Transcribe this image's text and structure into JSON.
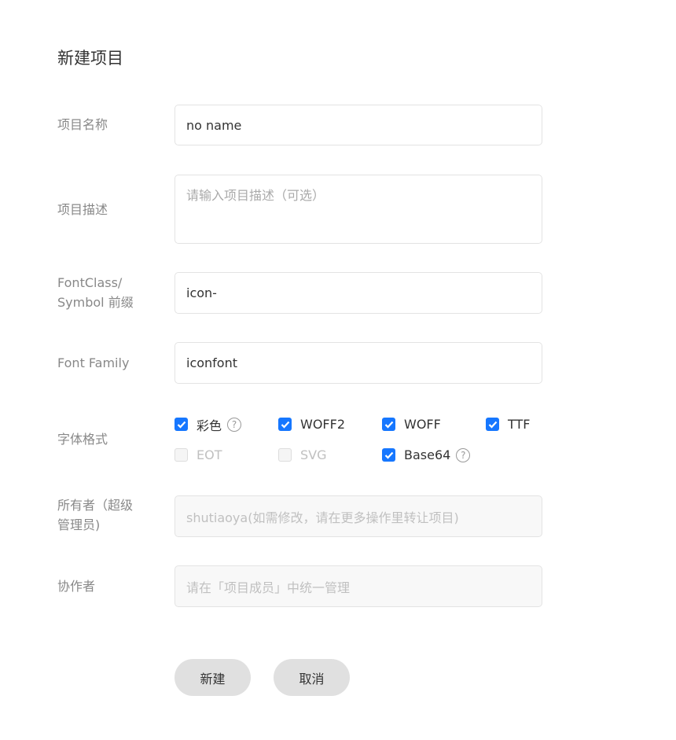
{
  "title": "新建项目",
  "fields": {
    "name": {
      "label": "项目名称",
      "value": "no name"
    },
    "description": {
      "label": "项目描述",
      "placeholder": "请输入项目描述（可选）"
    },
    "prefix": {
      "label_line1": "FontClass/",
      "label_line2": "Symbol 前缀",
      "value": "icon-"
    },
    "family": {
      "label": "Font Family",
      "value": "iconfont"
    },
    "formats": {
      "label": "字体格式",
      "options": [
        {
          "label": "彩色",
          "checked": true,
          "help": true
        },
        {
          "label": "WOFF2",
          "checked": true
        },
        {
          "label": "WOFF",
          "checked": true
        },
        {
          "label": "TTF",
          "checked": true
        },
        {
          "label": "EOT",
          "checked": false,
          "disabled": true
        },
        {
          "label": "SVG",
          "checked": false,
          "disabled": true
        },
        {
          "label": "Base64",
          "checked": true,
          "help": true
        }
      ]
    },
    "owner": {
      "label_line1": "所有者（超级",
      "label_line2": "管理员)",
      "value": "shutiaoya(如需修改，请在更多操作里转让项目)"
    },
    "collaborators": {
      "label": "协作者",
      "value": "请在「项目成员」中统一管理"
    }
  },
  "buttons": {
    "create": "新建",
    "cancel": "取消"
  },
  "colors": {
    "accent": "#1677ff"
  }
}
